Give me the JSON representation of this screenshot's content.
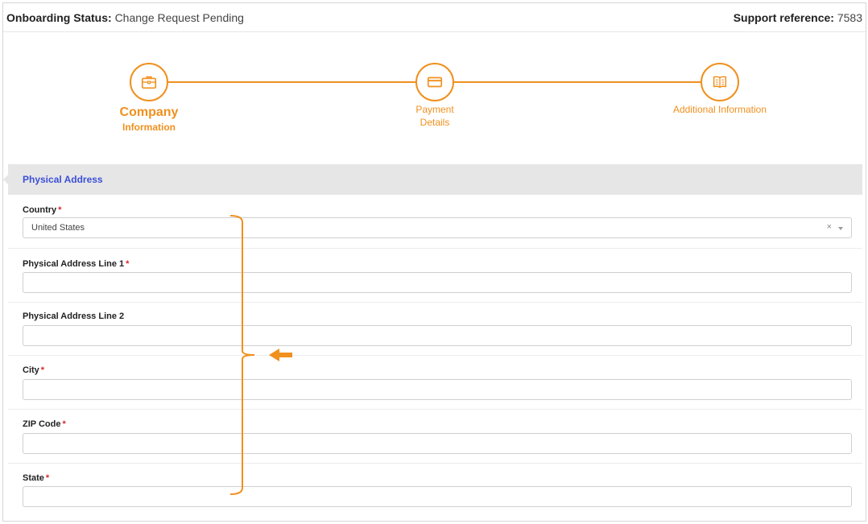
{
  "status": {
    "label": "Onboarding Status:",
    "value": "Change Request Pending",
    "ref_label": "Support reference:",
    "ref_value": "7583"
  },
  "stepper": {
    "steps": [
      {
        "line1": "Company",
        "line2": "Information",
        "icon": "briefcase-icon",
        "active": true
      },
      {
        "line1": "Payment",
        "line2": "Details",
        "icon": "credit-card-icon",
        "active": false
      },
      {
        "line1": "Additional Information",
        "line2": "",
        "icon": "book-icon",
        "active": false
      }
    ],
    "accent": "#f0901e"
  },
  "section": {
    "title": "Physical Address",
    "title_color": "#3b4fd8"
  },
  "fields": [
    {
      "label": "Country",
      "required": true,
      "type": "select",
      "value": "United States"
    },
    {
      "label": "Physical Address Line 1",
      "required": true,
      "type": "text",
      "value": ""
    },
    {
      "label": "Physical Address Line 2",
      "required": false,
      "type": "text",
      "value": ""
    },
    {
      "label": "City",
      "required": true,
      "type": "text",
      "value": ""
    },
    {
      "label": "ZIP Code",
      "required": true,
      "type": "text",
      "value": ""
    },
    {
      "label": "State",
      "required": true,
      "type": "text",
      "value": ""
    }
  ],
  "select": {
    "clear_symbol": "×"
  },
  "required_mark": "*"
}
